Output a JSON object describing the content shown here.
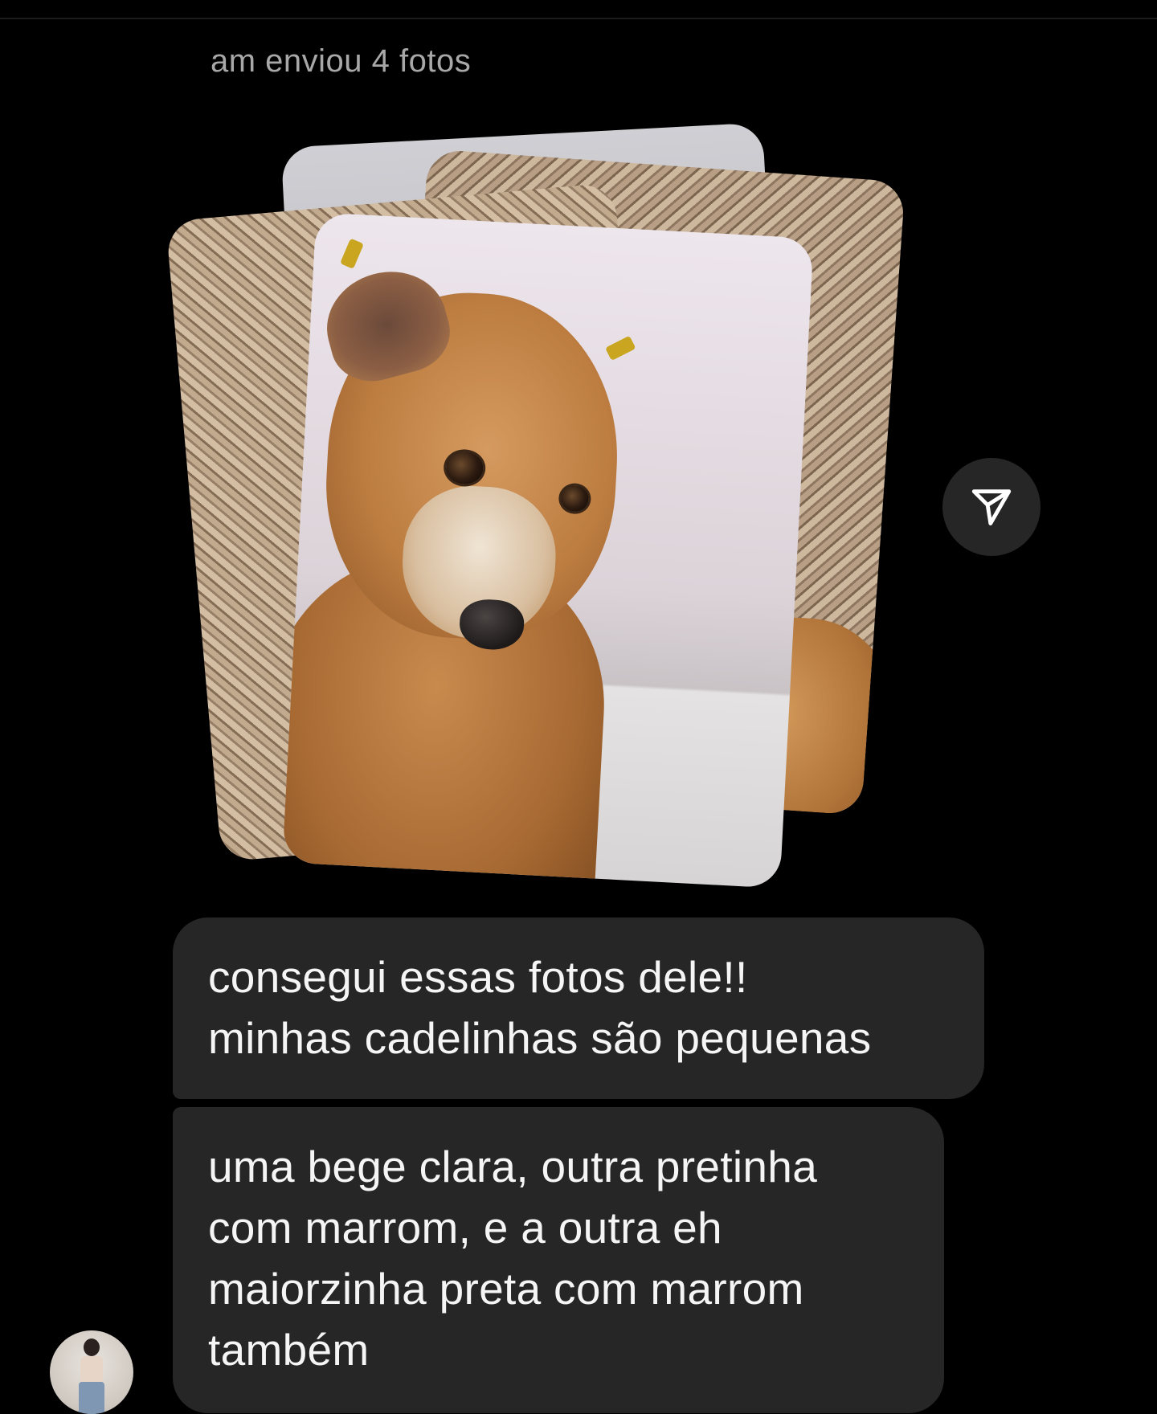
{
  "thread": {
    "caption": "am enviou 4 fotos"
  },
  "photo_stack": {
    "photo_count": 4,
    "front_photo": "dog-photo",
    "share_icon": "send-icon"
  },
  "messages": [
    {
      "lines": [
        "consegui essas fotos dele!!",
        "minhas cadelinhas são pequenas"
      ]
    },
    {
      "lines": [
        "uma bege clara, outra pretinha",
        "com marrom, e a outra eh",
        "maiorzinha preta com marrom",
        "também"
      ]
    }
  ],
  "avatar": {
    "icon": "profile-avatar"
  },
  "colors": {
    "background": "#000000",
    "bubble": "#262626",
    "caption": "#a8a8a8",
    "text": "#f5f5f5"
  }
}
